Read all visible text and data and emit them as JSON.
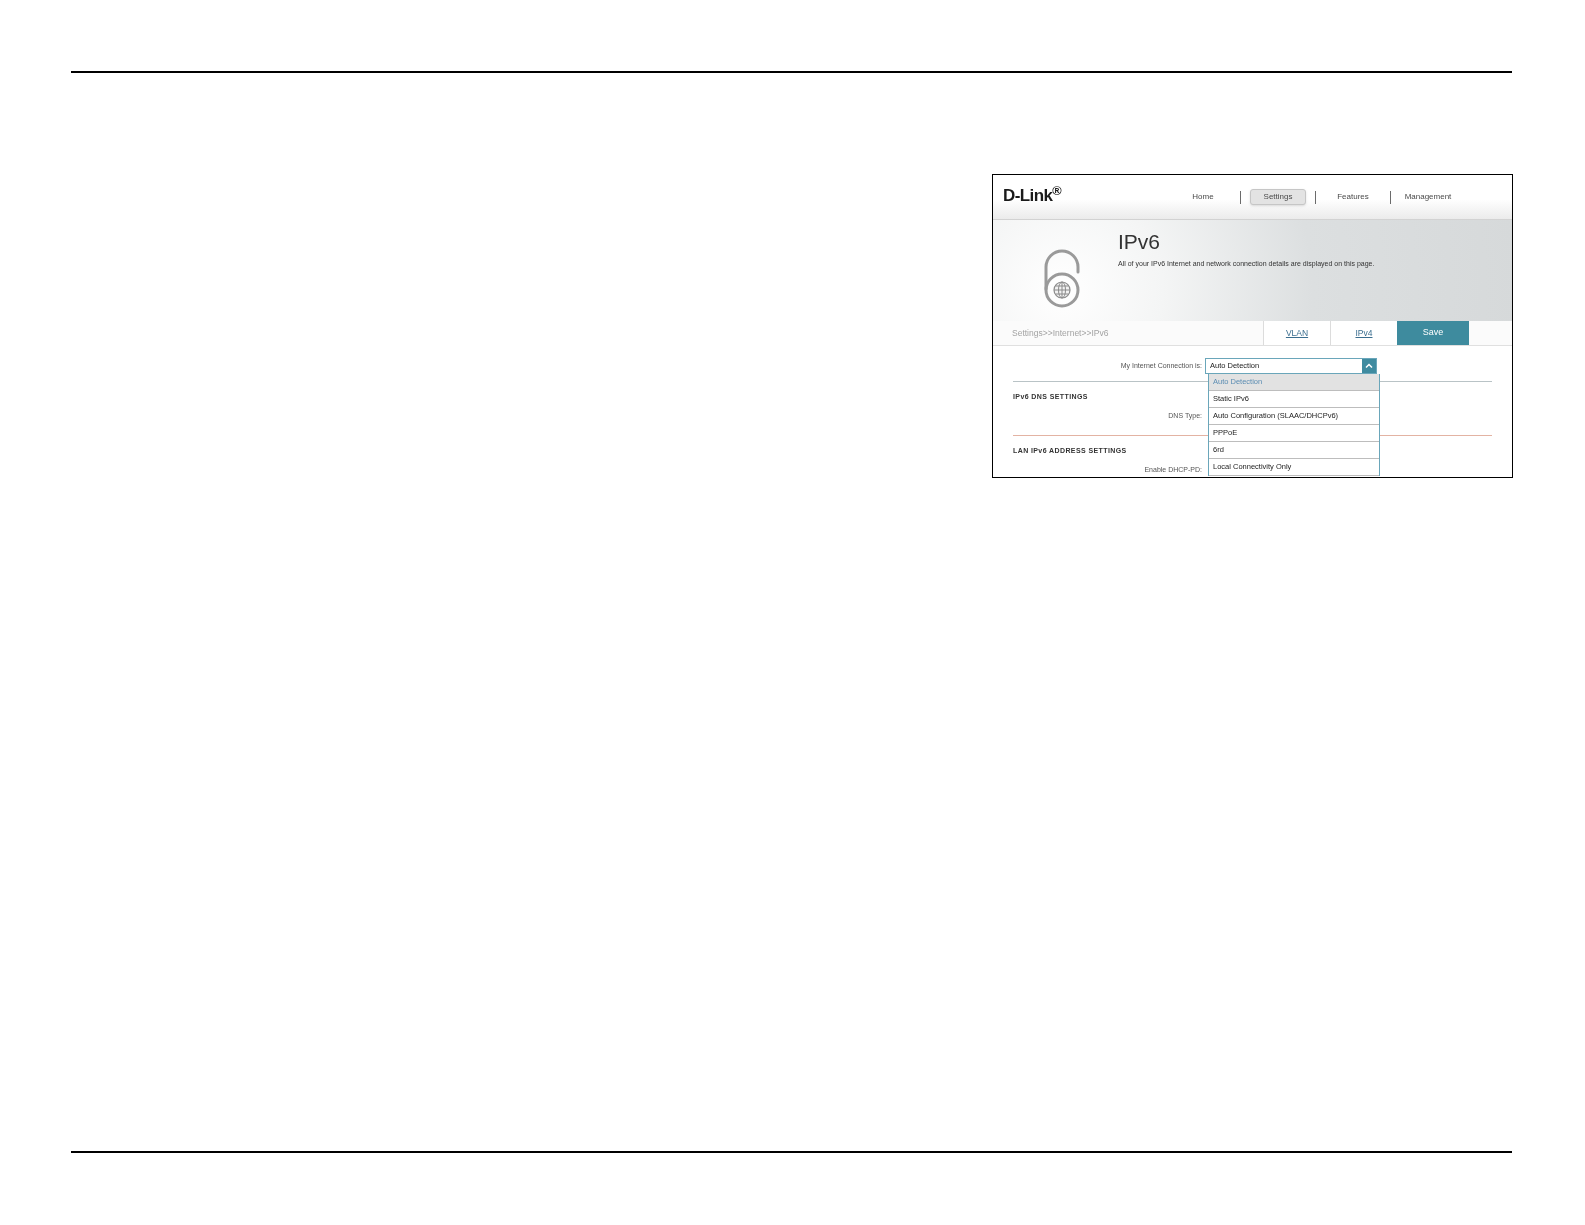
{
  "screenshot": {
    "logo": "D-Link$^{®}$",
    "nav": [
      {
        "label": "Home",
        "selected": false
      },
      {
        "label": "Settings",
        "selected": true
      },
      {
        "label": "Features",
        "selected": false
      },
      {
        "label": "Management",
        "selected": false
      }
    ],
    "page_title": "IPv6",
    "page_description": "All of your IPv6 Internet and network connection details are displayed on this page.",
    "breadcrumb": "Settings>>Internet>>IPv6",
    "tabs": [
      {
        "label": "VLAN",
        "kind": "link"
      },
      {
        "label": "IPv4",
        "kind": "link"
      },
      {
        "label": "Save",
        "kind": "button"
      }
    ],
    "connection": {
      "label": "My Internet Connection is:",
      "value": "Auto Detection",
      "expanded": true,
      "options": [
        {
          "label": "Auto Detection",
          "selected": true
        },
        {
          "label": "Static IPv6",
          "selected": false
        },
        {
          "label": "Auto Configuration (SLAAC/DHCPv6)",
          "selected": false
        },
        {
          "label": "PPPoE",
          "selected": false
        },
        {
          "label": "6rd",
          "selected": false
        },
        {
          "label": "Local Connectivity Only",
          "selected": false
        }
      ]
    },
    "sections": [
      {
        "title": "IPv6 DNS SETTINGS",
        "fields": [
          {
            "label": "DNS Type:"
          }
        ]
      },
      {
        "title": "LAN IPv6 ADDRESS SETTINGS",
        "fields": [
          {
            "label": "Enable DHCP-PD:"
          }
        ]
      }
    ]
  }
}
